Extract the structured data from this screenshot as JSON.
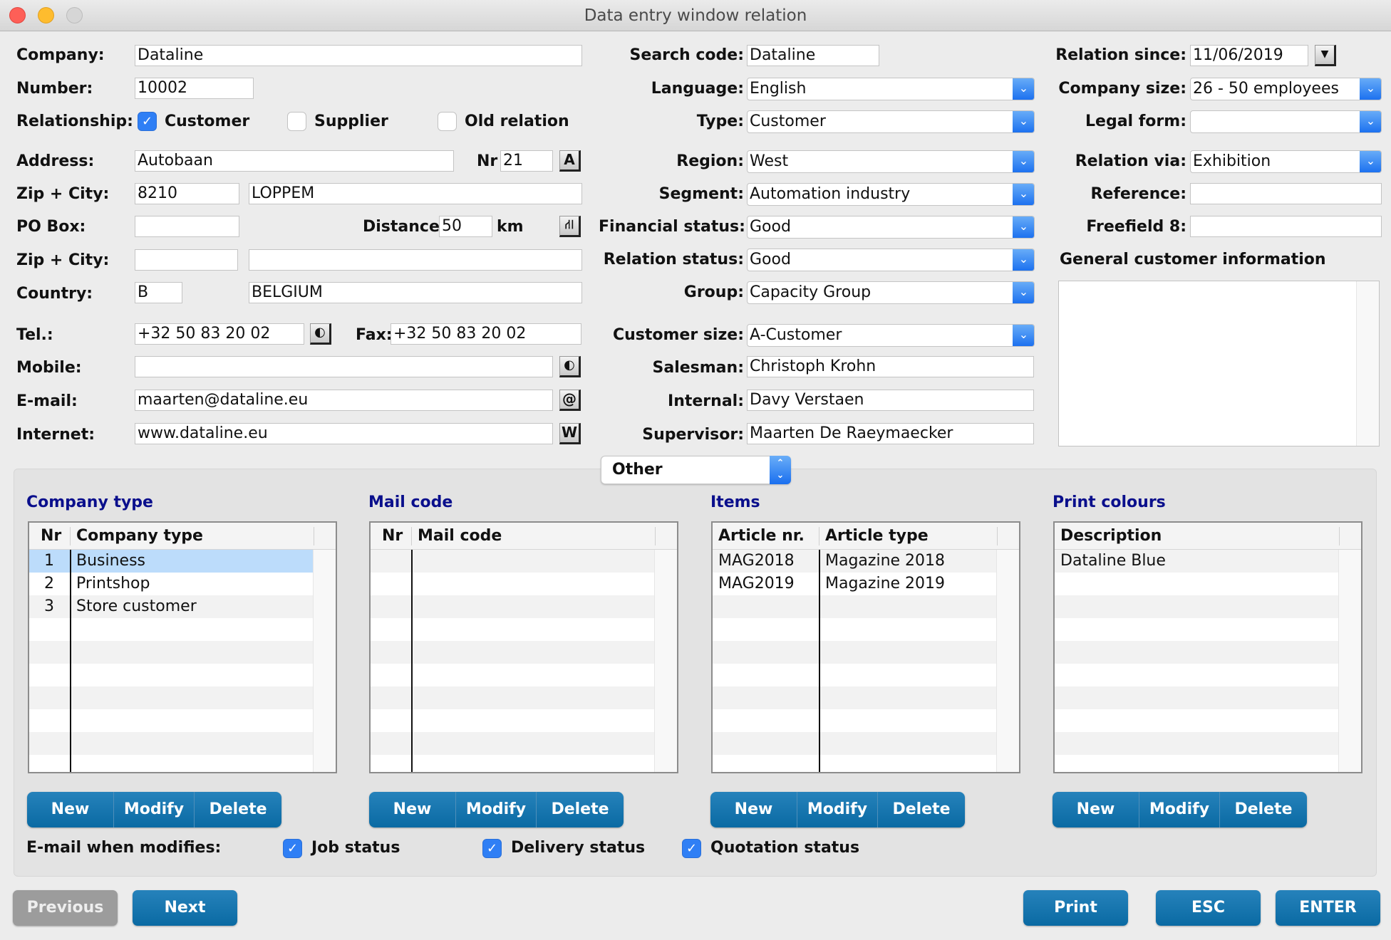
{
  "window": {
    "title": "Data entry window relation"
  },
  "left": {
    "company": {
      "label": "Company:",
      "value": "Dataline"
    },
    "number": {
      "label": "Number:",
      "value": "10002"
    },
    "relationship": {
      "label": "Relationship:",
      "options": [
        {
          "label": "Customer",
          "checked": true
        },
        {
          "label": "Supplier",
          "checked": false
        },
        {
          "label": "Old relation",
          "checked": false
        }
      ]
    },
    "address": {
      "label": "Address:",
      "value": "Autobaan",
      "nr_label": "Nr",
      "nr_value": "21",
      "icon": "A"
    },
    "zip_city": {
      "label": "Zip + City:",
      "zip": "8210",
      "city": "LOPPEM"
    },
    "po_box": {
      "label": "PO Box:",
      "value": ""
    },
    "distance": {
      "label": "Distance:",
      "value": "50",
      "unit": "km",
      "icon": "route"
    },
    "zip_city2": {
      "label": "Zip + City:",
      "zip": "",
      "city": ""
    },
    "country": {
      "label": "Country:",
      "code": "B",
      "name": "BELGIUM"
    },
    "tel": {
      "label": "Tel.:",
      "value": "+32 50 83 20 02"
    },
    "fax": {
      "label": "Fax:",
      "value": "+32 50 83 20 02"
    },
    "mobile": {
      "label": "Mobile:",
      "value": ""
    },
    "email": {
      "label": "E-mail:",
      "value": "maarten@dataline.eu",
      "icon": "@"
    },
    "internet": {
      "label": "Internet:",
      "value": "www.dataline.eu",
      "icon": "W"
    }
  },
  "middle": {
    "search_code": {
      "label": "Search code:",
      "value": "Dataline"
    },
    "language": {
      "label": "Language:",
      "value": "English"
    },
    "type": {
      "label": "Type:",
      "value": "Customer"
    },
    "region": {
      "label": "Region:",
      "value": "West"
    },
    "segment": {
      "label": "Segment:",
      "value": "Automation industry"
    },
    "financial_status": {
      "label": "Financial status:",
      "value": "Good"
    },
    "relation_status": {
      "label": "Relation status:",
      "value": "Good"
    },
    "group": {
      "label": "Group:",
      "value": "Capacity Group"
    },
    "customer_size": {
      "label": "Customer size:",
      "value": "A-Customer"
    },
    "salesman": {
      "label": "Salesman:",
      "value": "Christoph Krohn"
    },
    "internal": {
      "label": "Internal:",
      "value": "Davy Verstaen"
    },
    "supervisor": {
      "label": "Supervisor:",
      "value": "Maarten De Raeymaecker"
    }
  },
  "right": {
    "relation_since": {
      "label": "Relation since:",
      "value": "11/06/2019"
    },
    "company_size": {
      "label": "Company size:",
      "value": "26 - 50 employees"
    },
    "legal_form": {
      "label": "Legal form:",
      "value": ""
    },
    "relation_via": {
      "label": "Relation via:",
      "value": "Exhibition"
    },
    "reference": {
      "label": "Reference:",
      "value": ""
    },
    "freefield8": {
      "label": "Freefield 8:",
      "value": ""
    },
    "general_info": {
      "label": "General customer information",
      "value": ""
    }
  },
  "section_selector": {
    "value": "Other"
  },
  "tables": [
    {
      "title": "Company type",
      "columns": [
        "Nr",
        "Company type"
      ],
      "rows": [
        [
          "1",
          "Business"
        ],
        [
          "2",
          "Printshop"
        ],
        [
          "3",
          "Store customer"
        ]
      ],
      "selected_row": 0
    },
    {
      "title": "Mail code",
      "columns": [
        "Nr",
        "Mail code"
      ],
      "rows": [],
      "selected_row": -1
    },
    {
      "title": "Items",
      "columns": [
        "Article nr.",
        "Article type"
      ],
      "rows": [
        [
          "MAG2018",
          "Magazine 2018"
        ],
        [
          "MAG2019",
          "Magazine 2019"
        ]
      ],
      "selected_row": -1
    },
    {
      "title": "Print colours",
      "columns": [
        "Description"
      ],
      "rows": [
        [
          "Dataline Blue"
        ]
      ],
      "selected_row": -1
    }
  ],
  "table_buttons": {
    "new": "New",
    "modify": "Modify",
    "delete": "Delete"
  },
  "email_when_modifies": {
    "label": "E-mail when modifies:",
    "options": [
      {
        "label": "Job status",
        "checked": true
      },
      {
        "label": "Delivery status",
        "checked": true
      },
      {
        "label": "Quotation status",
        "checked": true
      }
    ]
  },
  "footer": {
    "previous": "Previous",
    "next": "Next",
    "print": "Print",
    "esc": "ESC",
    "enter": "ENTER"
  },
  "colors": {
    "accent_button": "#0a6aa3",
    "section_title": "#0a0f8c",
    "selected_row": "#bcdcfb",
    "checkbox": "#2f7ff5"
  }
}
